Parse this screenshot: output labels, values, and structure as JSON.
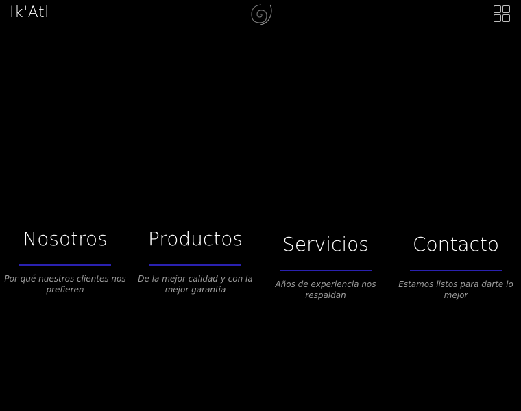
{
  "header": {
    "brand": "Ik'Atl",
    "logo_icon": "spiral-shell-icon",
    "menu_icon": "grid-menu-icon"
  },
  "sections": [
    {
      "title": "Nosotros",
      "subtitle": "Por qué nuestros clientes nos prefieren"
    },
    {
      "title": "Productos",
      "subtitle": "De la mejor calidad y con la mejor garantía"
    },
    {
      "title": "Servicios",
      "subtitle": "Años de experiencia nos respaldan"
    },
    {
      "title": "Contacto",
      "subtitle": "Estamos listos para darte lo mejor"
    }
  ],
  "colors": {
    "background": "#000000",
    "text": "#ffffff",
    "subtitle": "#9a9a9a",
    "accent_line": "#2a21b0",
    "icon": "#bdbdbd"
  }
}
